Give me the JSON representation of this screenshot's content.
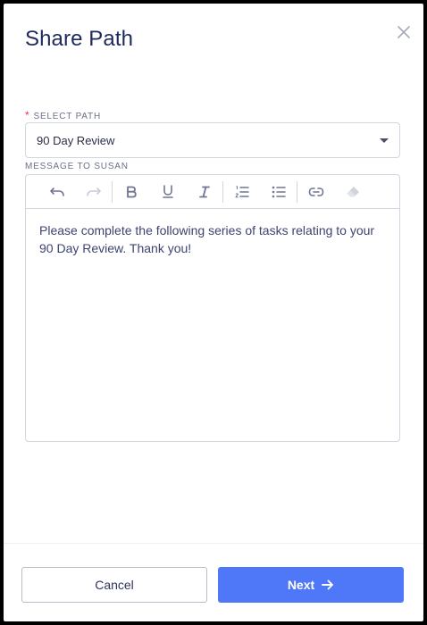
{
  "dialog": {
    "title": "Share Path",
    "close_icon": "close-icon"
  },
  "select_path": {
    "required_mark": "*",
    "label": "SELECT PATH",
    "value": "90 Day Review"
  },
  "message": {
    "label": "MESSAGE TO SUSAN",
    "body": "Please complete the following series of tasks relating to your 90 Day Review. Thank you!",
    "toolbar": [
      {
        "name": "undo-icon",
        "enabled": true
      },
      {
        "name": "redo-icon",
        "enabled": false
      },
      {
        "name": "bold-icon",
        "enabled": true
      },
      {
        "name": "underline-icon",
        "enabled": true
      },
      {
        "name": "italic-icon",
        "enabled": true
      },
      {
        "name": "ordered-list-icon",
        "enabled": true
      },
      {
        "name": "bullet-list-icon",
        "enabled": true
      },
      {
        "name": "link-icon",
        "enabled": true
      },
      {
        "name": "eraser-icon",
        "enabled": false
      }
    ]
  },
  "footer": {
    "cancel_label": "Cancel",
    "next_label": "Next",
    "next_icon": "arrow-right-icon"
  },
  "colors": {
    "primary": "#4f78f9",
    "title": "#1f2a5c",
    "required": "#e0334d"
  }
}
